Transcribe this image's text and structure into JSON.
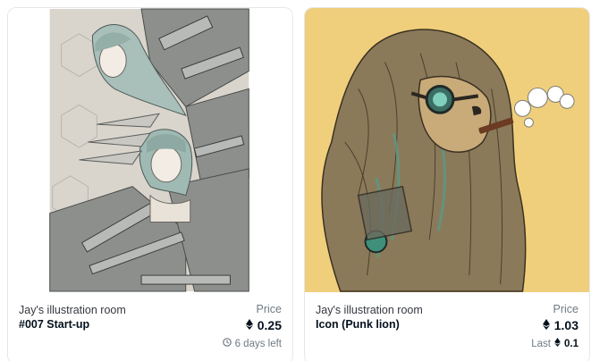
{
  "cards": [
    {
      "collection": "Jay's illustration room",
      "name": "#007 Start-up",
      "price_label": "Price",
      "price": "0.25",
      "price_icon": "ethereum-icon",
      "time_left": "6 days left",
      "time_icon": "clock-icon",
      "image": "anime-girls-mecha-illustration"
    },
    {
      "collection": "Jay's illustration room",
      "name": "Icon (Punk lion)",
      "price_label": "Price",
      "price": "1.03",
      "price_icon": "ethereum-icon",
      "last_label": "Last",
      "last_price": "0.1",
      "image": "punk-lion-with-goggles-and-cigar-illustration"
    }
  ],
  "colors": {
    "card_border": "#e5e8eb",
    "muted_text": "#707a83",
    "primary_text": "#04111d",
    "lion_background": "#f0cf7c"
  }
}
